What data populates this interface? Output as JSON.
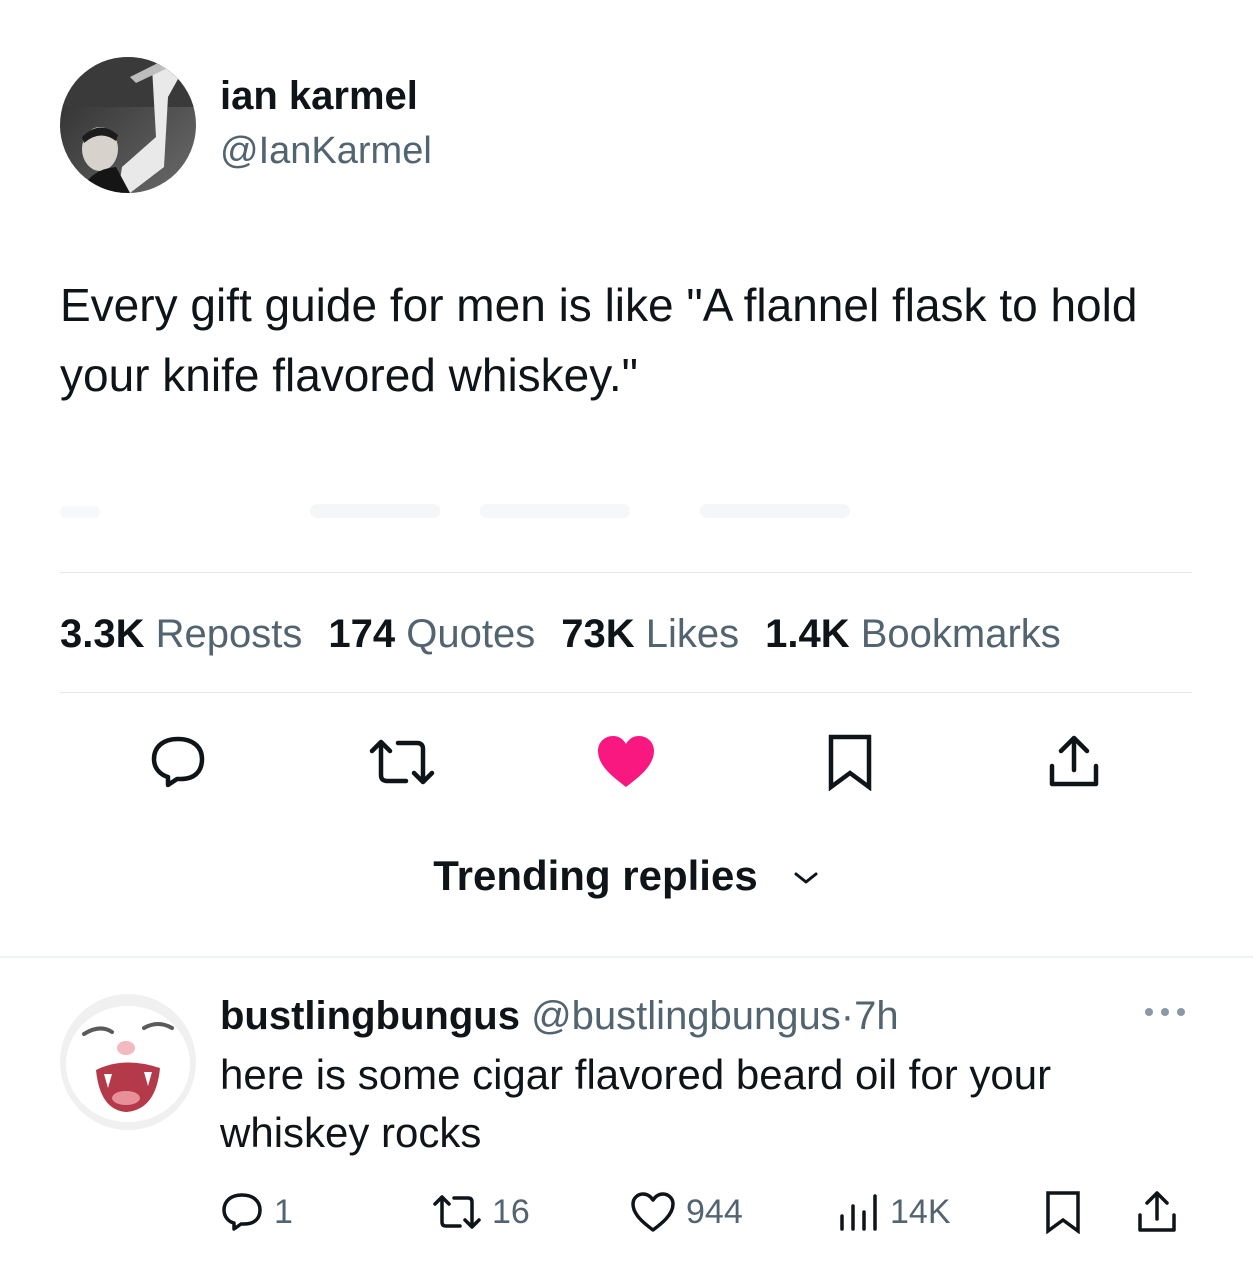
{
  "author": {
    "name": "ian karmel",
    "handle": "@IanKarmel"
  },
  "tweet": {
    "text": "Every gift guide for men is like \"A flannel flask to hold your knife flavored whiskey.\""
  },
  "stats": [
    {
      "value": "3.3K",
      "label": "Reposts"
    },
    {
      "value": "174",
      "label": "Quotes"
    },
    {
      "value": "73K",
      "label": "Likes"
    },
    {
      "value": "1.4K",
      "label": "Bookmarks"
    }
  ],
  "actions": {
    "reply_icon": "reply-icon",
    "repost_icon": "repost-icon",
    "like_icon": "heart-filled-icon",
    "bookmark_icon": "bookmark-icon",
    "share_icon": "share-icon",
    "like_color": "#f91880"
  },
  "replies_sort": {
    "label": "Trending replies"
  },
  "reply": {
    "name": "bustlingbungus",
    "handle": "@bustlingbungus",
    "separator": "·",
    "time": "7h",
    "text": "here is some cigar flavored beard oil for your whiskey rocks",
    "counts": {
      "replies": "1",
      "reposts": "16",
      "likes": "944",
      "views": "14K"
    }
  }
}
